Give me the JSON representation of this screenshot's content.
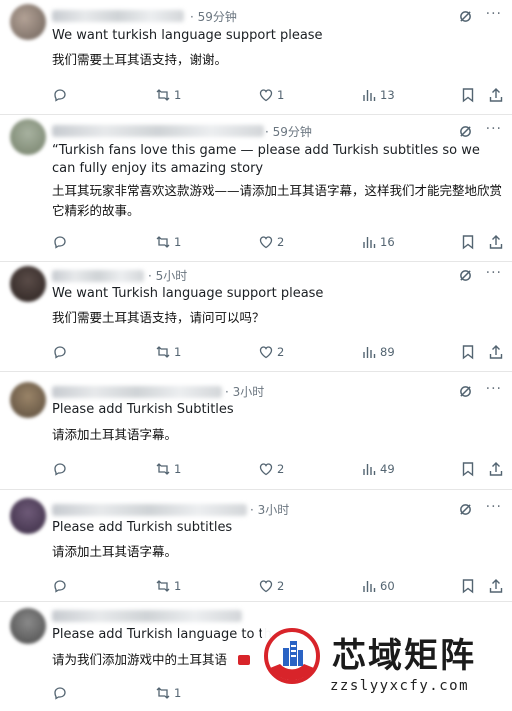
{
  "tweets": [
    {
      "time": "· 59分钟",
      "en": "We want turkish language support please",
      "zh": "我们需要土耳其语支持，谢谢。",
      "retweets": "1",
      "likes": "1",
      "views": "13"
    },
    {
      "time": "· 59分钟",
      "en": "“Turkish fans love this game — please add Turkish subtitles so we can fully enjoy its amazing story",
      "zh": "土耳其玩家非常喜欢这款游戏——请添加土耳其语字幕，这样我们才能完整地欣赏它精彩的故事。",
      "retweets": "1",
      "likes": "2",
      "views": "16"
    },
    {
      "time": "· 5小时",
      "en": "We want Turkish language support please",
      "zh": "我们需要土耳其语支持，请问可以吗？",
      "retweets": "1",
      "likes": "2",
      "views": "89"
    },
    {
      "time": "· 3小时",
      "en": "Please add Turkish Subtitles",
      "zh": "请添加土耳其语字幕。",
      "retweets": "1",
      "likes": "2",
      "views": "49"
    },
    {
      "time": "· 3小时",
      "en": "Please add Turkish subtitles",
      "zh": "请添加土耳其语字幕。",
      "retweets": "1",
      "likes": "2",
      "views": "60"
    },
    {
      "time": "",
      "en": "Please add Turkish language to th",
      "zh": "请为我们添加游戏中的土耳其语",
      "retweets": "1",
      "likes": "",
      "views": ""
    }
  ],
  "watermark": {
    "title": "芯域矩阵",
    "url": "zzslyyxcfy.com"
  },
  "colors": {
    "accent": "#536471",
    "text": "#0f1419",
    "badge_red": "#d8242a",
    "badge_blue": "#2a63c4"
  }
}
